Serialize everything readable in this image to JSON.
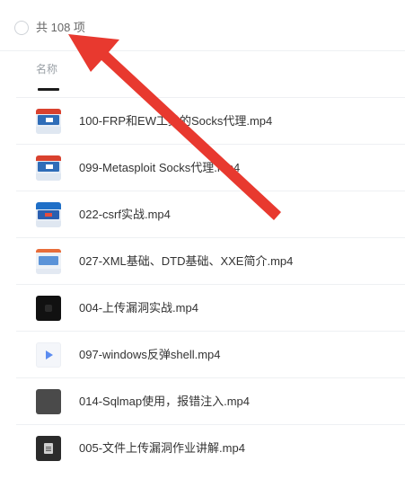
{
  "header": {
    "count_label": "共 108 项",
    "column_name": "名称"
  },
  "files": [
    {
      "name": "100-FRP和EW工具的Socks代理.mp4",
      "thumb": "video-red"
    },
    {
      "name": "099-Metasploit Socks代理.mp4",
      "thumb": "video-red"
    },
    {
      "name": "022-csrf实战.mp4",
      "thumb": "video-blue"
    },
    {
      "name": "027-XML基础、DTD基础、XXE简介.mp4",
      "thumb": "video-orange"
    },
    {
      "name": "004-上传漏洞实战.mp4",
      "thumb": "dark"
    },
    {
      "name": "097-windows反弹shell.mp4",
      "thumb": "play"
    },
    {
      "name": "014-Sqlmap使用，报错注入.mp4",
      "thumb": "gray"
    },
    {
      "name": "005-文件上传漏洞作业讲解.mp4",
      "thumb": "doc"
    }
  ],
  "annotation": {
    "arrow_color": "#e8392f"
  },
  "colors": {
    "divider": "#eef0f3",
    "muted_text": "#9aa0a6",
    "primary_text": "#333333"
  }
}
